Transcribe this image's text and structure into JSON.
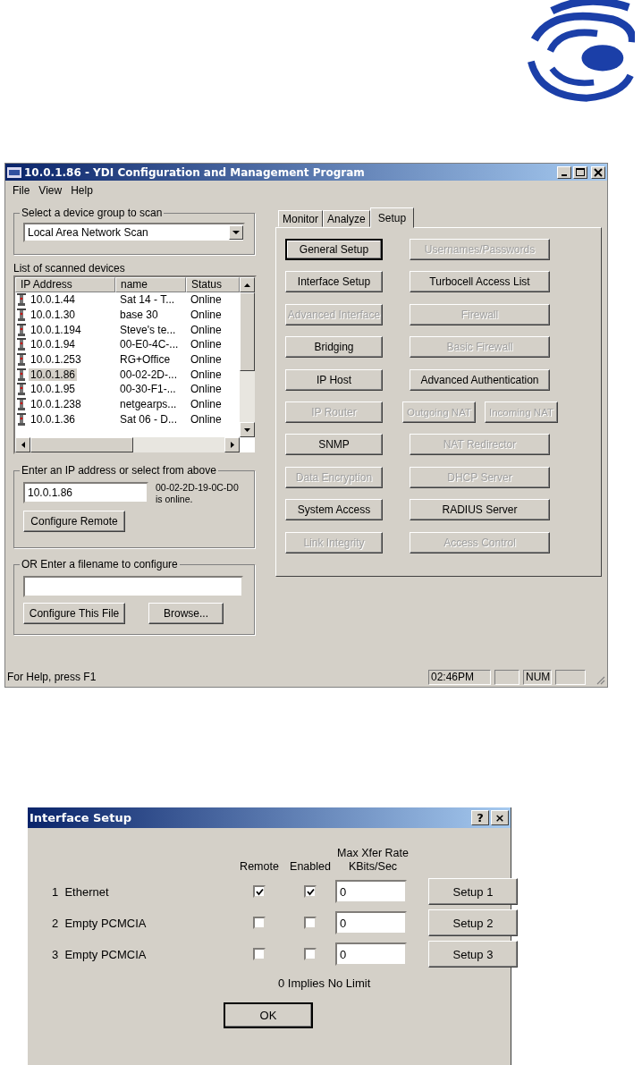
{
  "main_window": {
    "title": "10.0.1.86 - YDI Configuration and Management Program",
    "menu": [
      "File",
      "View",
      "Help"
    ],
    "scan_group": {
      "legend": "Select a device group to scan",
      "dropdown_value": "Local Area Network Scan"
    },
    "device_list": {
      "label": "List of scanned devices",
      "columns": [
        "IP Address",
        "name",
        "Status"
      ],
      "rows": [
        {
          "ip": "10.0.1.44",
          "name": "Sat 14 - T...",
          "status": "Online",
          "selected": false
        },
        {
          "ip": "10.0.1.30",
          "name": "base 30",
          "status": "Online",
          "selected": false
        },
        {
          "ip": "10.0.1.194",
          "name": "Steve's te...",
          "status": "Online",
          "selected": false
        },
        {
          "ip": "10.0.1.94",
          "name": "00-E0-4C-...",
          "status": "Online",
          "selected": false
        },
        {
          "ip": "10.0.1.253",
          "name": "RG+Office",
          "status": "Online",
          "selected": false
        },
        {
          "ip": "10.0.1.86",
          "name": "00-02-2D-...",
          "status": "Online",
          "selected": true
        },
        {
          "ip": "10.0.1.95",
          "name": "00-30-F1-...",
          "status": "Online",
          "selected": false
        },
        {
          "ip": "10.0.1.238",
          "name": "netgearps...",
          "status": "Online",
          "selected": false
        },
        {
          "ip": "10.0.1.36",
          "name": "Sat 06 - D...",
          "status": "Online",
          "selected": false
        }
      ]
    },
    "ip_group": {
      "legend": "Enter an IP address or select from above",
      "value": "10.0.1.86",
      "status_text": "00-02-2D-19-0C-D0 is online.",
      "button": "Configure Remote"
    },
    "file_group": {
      "legend": "OR Enter a filename to configure",
      "buttons": [
        "Configure This File",
        "Browse..."
      ]
    },
    "tabs": [
      {
        "label": "Monitor",
        "selected": false
      },
      {
        "label": "Analyze",
        "selected": false
      },
      {
        "label": "Setup",
        "selected": true
      }
    ],
    "setup_rows": [
      {
        "left": {
          "label": "General Setup",
          "disabled": false,
          "default": true
        },
        "right": [
          {
            "label": "Usernames/Passwords",
            "disabled": true
          }
        ]
      },
      {
        "left": {
          "label": "Interface Setup",
          "disabled": false,
          "default": false
        },
        "right": [
          {
            "label": "Turbocell Access List",
            "disabled": false
          }
        ]
      },
      {
        "left": {
          "label": "Advanced Interface",
          "disabled": true,
          "default": false
        },
        "right": [
          {
            "label": "Firewall",
            "disabled": true
          }
        ]
      },
      {
        "left": {
          "label": "Bridging",
          "disabled": false,
          "default": false
        },
        "right": [
          {
            "label": "Basic Firewall",
            "disabled": true
          }
        ]
      },
      {
        "left": {
          "label": "IP Host",
          "disabled": false,
          "default": false
        },
        "right": [
          {
            "label": "Advanced Authentication",
            "disabled": false
          }
        ]
      },
      {
        "left": {
          "label": "IP Router",
          "disabled": true,
          "default": false
        },
        "right": [
          {
            "label": "Outgoing NAT",
            "disabled": true
          },
          {
            "label": "Incoming NAT",
            "disabled": true
          }
        ]
      },
      {
        "left": {
          "label": "SNMP",
          "disabled": false,
          "default": false
        },
        "right": [
          {
            "label": "NAT Redirector",
            "disabled": true
          }
        ]
      },
      {
        "left": {
          "label": "Data Encryption",
          "disabled": true,
          "default": false
        },
        "right": [
          {
            "label": "DHCP Server",
            "disabled": true
          }
        ]
      },
      {
        "left": {
          "label": "System Access",
          "disabled": false,
          "default": false
        },
        "right": [
          {
            "label": "RADIUS Server",
            "disabled": false
          }
        ]
      },
      {
        "left": {
          "label": "Link Integrity",
          "disabled": true,
          "default": false
        },
        "right": [
          {
            "label": "Access Control",
            "disabled": true
          }
        ]
      }
    ],
    "status_bar": {
      "help": "For Help, press F1",
      "panels": [
        "02:46PM",
        "NUM"
      ]
    }
  },
  "dialog": {
    "title": "Interface Setup",
    "help_button": "?",
    "close_button": "×",
    "columns": [
      "Remote",
      "Enabled",
      "Max Xfer Rate KBits/Sec"
    ],
    "rows": [
      {
        "number": "1",
        "name": "Ethernet",
        "remote": true,
        "enabled": true,
        "rate": "0",
        "button": "Setup 1"
      },
      {
        "number": "2",
        "name": "Empty PCMCIA",
        "remote": false,
        "enabled": false,
        "rate": "0",
        "button": "Setup 2"
      },
      {
        "number": "3",
        "name": "Empty PCMCIA",
        "remote": false,
        "enabled": false,
        "rate": "0",
        "button": "Setup 3"
      }
    ],
    "note": "0 Implies No Limit",
    "ok_button": "OK"
  }
}
